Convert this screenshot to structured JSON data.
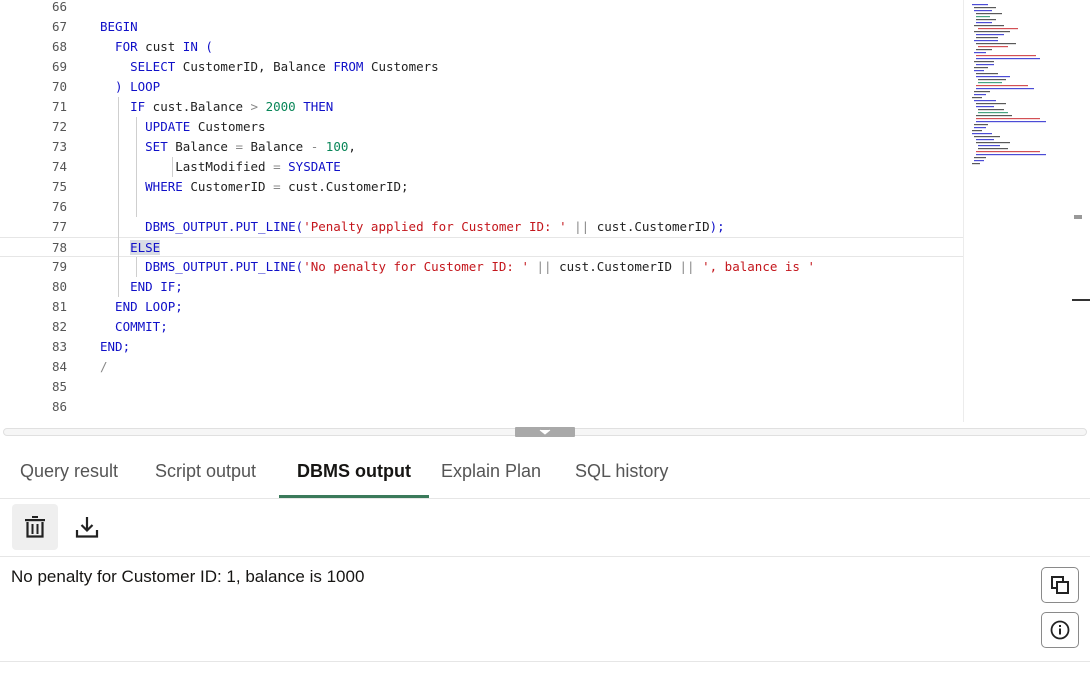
{
  "editor": {
    "lines": [
      {
        "n": "66",
        "tokens": []
      },
      {
        "n": "67",
        "tokens": [
          {
            "t": "BEGIN",
            "c": "kw"
          }
        ]
      },
      {
        "n": "68",
        "tokens": [
          {
            "t": "  FOR",
            "c": "kw"
          },
          {
            "t": " cust "
          },
          {
            "t": "IN",
            "c": "kw"
          },
          {
            "t": " (",
            "c": "kw"
          }
        ]
      },
      {
        "n": "69",
        "tokens": [
          {
            "t": "    SELECT",
            "c": "kw"
          },
          {
            "t": " CustomerID, Balance "
          },
          {
            "t": "FROM",
            "c": "kw"
          },
          {
            "t": " Customers"
          }
        ]
      },
      {
        "n": "70",
        "tokens": [
          {
            "t": "  ) LOOP",
            "c": "kw"
          }
        ]
      },
      {
        "n": "71",
        "tokens": [
          {
            "t": "    IF",
            "c": "kw"
          },
          {
            "t": " cust.Balance "
          },
          {
            "t": ">",
            "c": "op"
          },
          {
            "t": " "
          },
          {
            "t": "2000",
            "c": "num"
          },
          {
            "t": " "
          },
          {
            "t": "THEN",
            "c": "kw"
          }
        ]
      },
      {
        "n": "72",
        "tokens": [
          {
            "t": "      UPDATE",
            "c": "kw"
          },
          {
            "t": " Customers"
          }
        ]
      },
      {
        "n": "73",
        "tokens": [
          {
            "t": "      SET",
            "c": "kw"
          },
          {
            "t": " Balance "
          },
          {
            "t": "=",
            "c": "op"
          },
          {
            "t": " Balance "
          },
          {
            "t": "-",
            "c": "op"
          },
          {
            "t": " "
          },
          {
            "t": "100",
            "c": "num"
          },
          {
            "t": ","
          }
        ]
      },
      {
        "n": "74",
        "tokens": [
          {
            "t": "          LastModified "
          },
          {
            "t": "=",
            "c": "op"
          },
          {
            "t": " "
          },
          {
            "t": "SYSDATE",
            "c": "kw"
          }
        ]
      },
      {
        "n": "75",
        "tokens": [
          {
            "t": "      WHERE",
            "c": "kw"
          },
          {
            "t": " CustomerID "
          },
          {
            "t": "=",
            "c": "op"
          },
          {
            "t": " cust.CustomerID;"
          }
        ]
      },
      {
        "n": "76",
        "tokens": []
      },
      {
        "n": "77",
        "tokens": [
          {
            "t": "      DBMS_OUTPUT.PUT_LINE(",
            "c": "kw"
          },
          {
            "t": "'Penalty applied for Customer ID: '",
            "c": "str"
          },
          {
            "t": " "
          },
          {
            "t": "||",
            "c": "op"
          },
          {
            "t": " cust.CustomerID"
          },
          {
            "t": ");",
            "c": "kw"
          }
        ]
      },
      {
        "n": "78",
        "tokens": [
          {
            "t": "    "
          },
          {
            "t": "ELSE",
            "c": "kw sel"
          }
        ]
      },
      {
        "n": "79",
        "tokens": [
          {
            "t": "      DBMS_OUTPUT.PUT_LINE(",
            "c": "kw"
          },
          {
            "t": "'No penalty for Customer ID: '",
            "c": "str"
          },
          {
            "t": " "
          },
          {
            "t": "||",
            "c": "op"
          },
          {
            "t": " cust.CustomerID "
          },
          {
            "t": "||",
            "c": "op"
          },
          {
            "t": " "
          },
          {
            "t": "', balance is '",
            "c": "str"
          }
        ]
      },
      {
        "n": "80",
        "tokens": [
          {
            "t": "    END IF;",
            "c": "kw"
          }
        ]
      },
      {
        "n": "81",
        "tokens": [
          {
            "t": "  END LOOP;",
            "c": "kw"
          }
        ]
      },
      {
        "n": "82",
        "tokens": [
          {
            "t": "  COMMIT;",
            "c": "kw"
          }
        ]
      },
      {
        "n": "83",
        "tokens": [
          {
            "t": "END;",
            "c": "kw"
          }
        ]
      },
      {
        "n": "84",
        "tokens": [
          {
            "t": "/",
            "c": "op"
          }
        ]
      },
      {
        "n": "85",
        "tokens": []
      },
      {
        "n": "86",
        "tokens": []
      }
    ]
  },
  "colors": {
    "keyword": "#1010c8",
    "string": "#c4161c",
    "number": "#098658",
    "active_tab_underline": "#3a7a5a"
  },
  "tabs": [
    {
      "label": "Query result",
      "active": false
    },
    {
      "label": "Script output",
      "active": false
    },
    {
      "label": "DBMS output",
      "active": true
    },
    {
      "label": "Explain Plan",
      "active": false
    },
    {
      "label": "SQL history",
      "active": false
    }
  ],
  "toolbar": {
    "clear_icon": "trash-icon",
    "download_icon": "download-icon"
  },
  "output": {
    "text": "No penalty for Customer ID: 1, balance is 1000"
  },
  "side_buttons": {
    "copy_icon": "copy-icon",
    "info_icon": "info-icon"
  }
}
